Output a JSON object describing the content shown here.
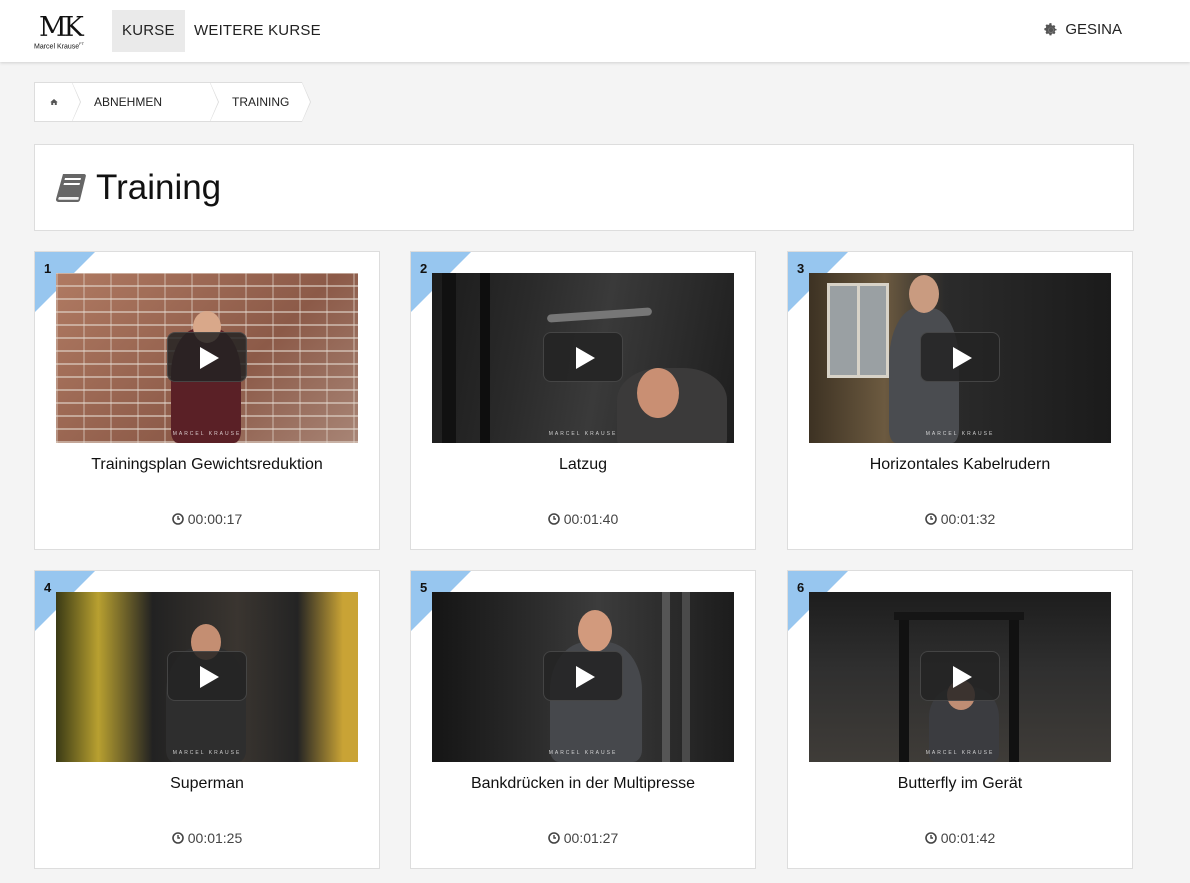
{
  "header": {
    "logo": {
      "mark": "MK",
      "subtitle": "Marcel Krause",
      "subtitle_sup": "FT"
    },
    "nav": [
      {
        "label": "KURSE",
        "active": true
      },
      {
        "label": "WEITERE KURSE",
        "active": false
      }
    ],
    "user": {
      "icon": "gear-icon",
      "label": "GESINA"
    }
  },
  "breadcrumb": {
    "home_icon": "home-icon",
    "items": [
      "ABNEHMEN",
      "TRAINING"
    ]
  },
  "page": {
    "title_icon": "book-icon",
    "title": "Training"
  },
  "colors": {
    "corner_badge": "#97c6ef",
    "background": "#f4f4f4",
    "panel": "#ffffff"
  },
  "videos": [
    {
      "number": "1",
      "title": "Trainingsplan Gewichtsreduktion",
      "duration": "00:00:17",
      "watermark": "MARCEL KRAUSE"
    },
    {
      "number": "2",
      "title": "Latzug",
      "duration": "00:01:40",
      "watermark": "MARCEL KRAUSE"
    },
    {
      "number": "3",
      "title": "Horizontales Kabelrudern",
      "duration": "00:01:32",
      "watermark": "MARCEL KRAUSE"
    },
    {
      "number": "4",
      "title": "Superman",
      "duration": "00:01:25",
      "watermark": "MARCEL KRAUSE"
    },
    {
      "number": "5",
      "title": "Bankdrücken in der Multipresse",
      "duration": "00:01:27",
      "watermark": "MARCEL KRAUSE"
    },
    {
      "number": "6",
      "title": "Butterfly im Gerät",
      "duration": "00:01:42",
      "watermark": "MARCEL KRAUSE"
    }
  ]
}
